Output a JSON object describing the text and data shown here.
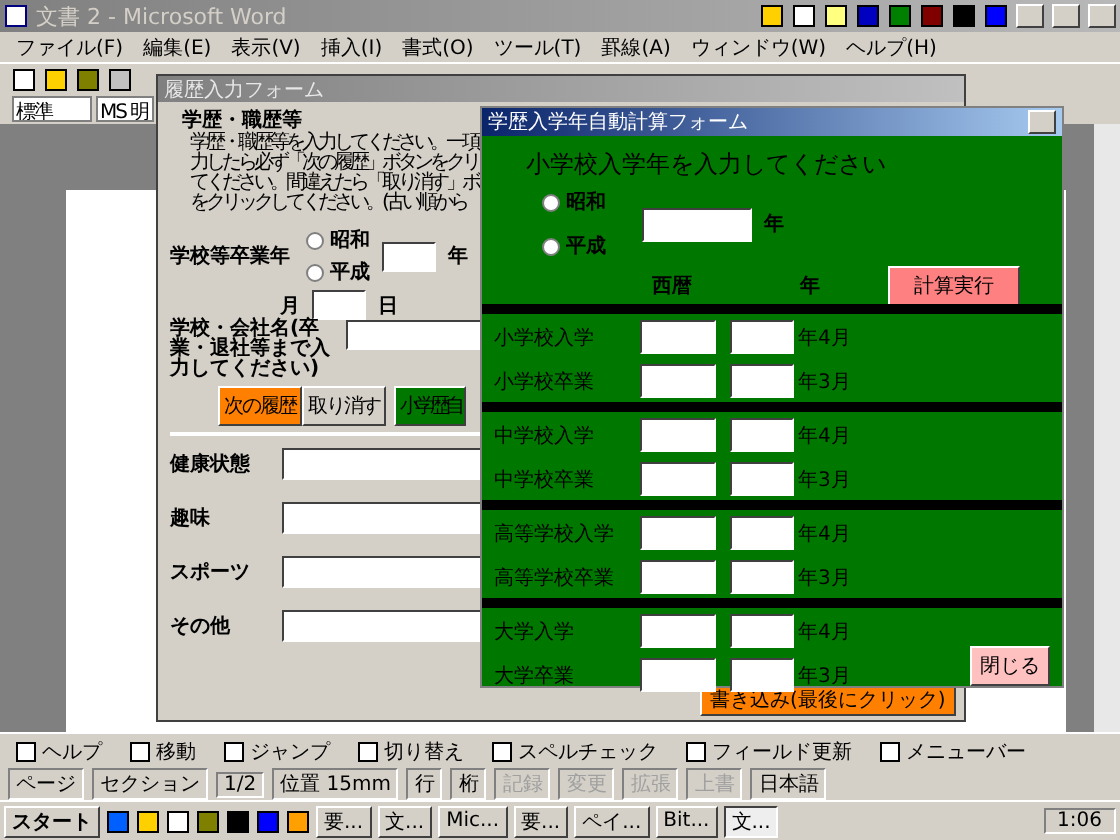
{
  "word_window": {
    "title": "文書 2 - Microsoft Word",
    "menu": [
      "ファイル(F)",
      "編集(E)",
      "表示(V)",
      "挿入(I)",
      "書式(O)",
      "ツール(T)",
      "罫線(A)",
      "ウィンドウ(W)",
      "ヘルプ(H)"
    ],
    "style_box": "標準",
    "font_box": "MS 明"
  },
  "history_form": {
    "title": "履歴入力フォーム",
    "heading": "学歴・職歴等",
    "instructions": [
      "学歴・職歴等を入力してください。一項",
      "力したら必ず「次の履歴」ボタンをクリ",
      "てください。間違えたら「取り消す」ボ",
      "をクリックしてください。(古い順から"
    ],
    "graduation_label": "学校等卒業年",
    "eras": [
      {
        "label": "昭和",
        "selected": false
      },
      {
        "label": "平成",
        "selected": false
      }
    ],
    "year_unit": "年",
    "month_label": "月",
    "day_unit": "日",
    "school_label": "学校・会社名(卒業・退社等まで入力してください)",
    "buttons": [
      {
        "label": "次の履歴",
        "kind": "orange"
      },
      {
        "label": "取り消す",
        "kind": "plain"
      },
      {
        "label": "小学歴自",
        "kind": "green"
      }
    ],
    "fields": [
      {
        "label": "健康状態"
      },
      {
        "label": "趣味"
      },
      {
        "label": "スポーツ"
      },
      {
        "label": "その他"
      }
    ],
    "write_button": "書き込み(最後にクリック)"
  },
  "calc_form": {
    "title": "学歴入学年自動計算フォーム",
    "prompt": "小学校入学年を入力してください",
    "eras": [
      {
        "label": "昭和",
        "selected": false
      },
      {
        "label": "平成",
        "selected": false
      }
    ],
    "year_unit": "年",
    "western_label": "西暦",
    "western_unit": "年",
    "calc_button": "計算実行",
    "sections": [
      {
        "rows": [
          {
            "label": "小学校入学",
            "suffix": "年4月"
          },
          {
            "label": "小学校卒業",
            "suffix": "年3月"
          }
        ]
      },
      {
        "rows": [
          {
            "label": "中学校入学",
            "suffix": "年4月"
          },
          {
            "label": "中学校卒業",
            "suffix": "年3月"
          }
        ]
      },
      {
        "rows": [
          {
            "label": "高等学校入学",
            "suffix": "年4月"
          },
          {
            "label": "高等学校卒業",
            "suffix": "年3月"
          }
        ]
      },
      {
        "rows": [
          {
            "label": "大学入学",
            "suffix": "年4月"
          },
          {
            "label": "大学卒業",
            "suffix": "年3月"
          }
        ]
      }
    ],
    "close_button": "閉じる"
  },
  "function_keys": [
    "ヘルプ",
    "移動",
    "ジャンプ",
    "切り替え",
    "スペルチェック",
    "フィールド更新",
    "メニューバー"
  ],
  "status_bar": {
    "page": "ページ",
    "section": "セクション",
    "pages": "1/2",
    "position": "位置 15mm",
    "line": "行",
    "column": "桁",
    "modes": [
      {
        "label": "記録",
        "on": false
      },
      {
        "label": "変更",
        "on": false
      },
      {
        "label": "拡張",
        "on": false
      },
      {
        "label": "上書",
        "on": false
      }
    ],
    "language": "日本語"
  },
  "taskbar": {
    "start": "スタート",
    "tasks": [
      {
        "label": "要...",
        "selected": false
      },
      {
        "label": "文...",
        "selected": false
      },
      {
        "label": "Mic...",
        "selected": false
      },
      {
        "label": "要...",
        "selected": false
      },
      {
        "label": "ペイ...",
        "selected": false
      },
      {
        "label": "Bit...",
        "selected": false
      },
      {
        "label": "文...",
        "selected": true
      }
    ],
    "clock": "1:06"
  }
}
